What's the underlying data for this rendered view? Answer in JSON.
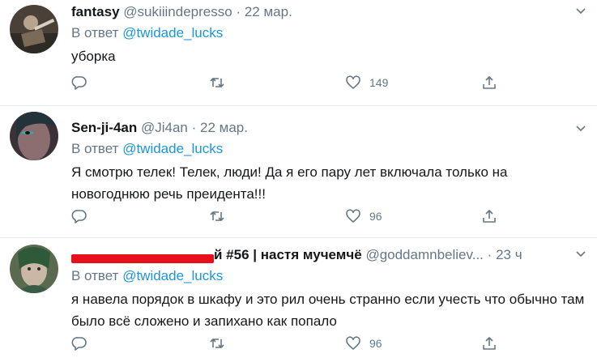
{
  "tweets": [
    {
      "name": "fantasy",
      "handle": "@sukiiindepresso",
      "dot": "·",
      "time": "22 мар.",
      "reply_prefix": "В ответ",
      "reply_to": "@twidade_lucks",
      "text": "уборка",
      "likes": "149"
    },
    {
      "name": "Sen-ji-4an",
      "handle": "@Ji4an",
      "dot": "·",
      "time": "22 мар.",
      "reply_prefix": "В ответ",
      "reply_to": "@twidade_lucks",
      "text": "Я смотрю телек! Телек, люди! Да я его пару лет включала только на новогоднюю речь преидента!!!",
      "likes": "96"
    },
    {
      "name_visible_tail": "й #56 | настя мучемчё",
      "handle": "@goddamnbeliev...",
      "dot": "·",
      "time": "23 ч",
      "reply_prefix": "В ответ",
      "reply_to": "@twidade_lucks",
      "text": "я навела порядок в шкафу и это рил очень странно если учесть что обычно там было всё сложено и запихано как попало",
      "likes": "96"
    }
  ],
  "colors": {
    "accent": "#1b95e0",
    "muted": "#657786",
    "redaction": "#e8101a"
  },
  "icons": [
    "reply-icon",
    "retweet-icon",
    "like-icon",
    "share-icon",
    "chevron-down-icon"
  ]
}
